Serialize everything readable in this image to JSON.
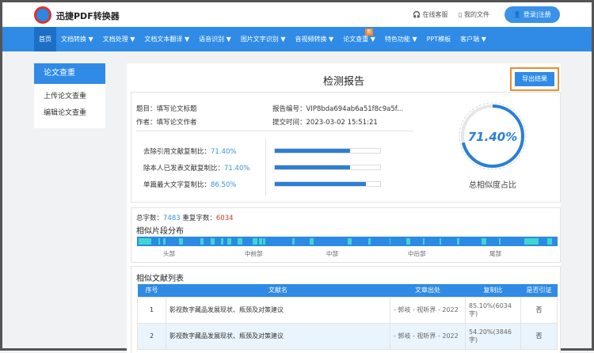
{
  "header": {
    "brand": "迅捷PDF转换器",
    "service": "在线客服",
    "files": "我的文件",
    "login": "登录|注册"
  },
  "nav": [
    {
      "label": "首页"
    },
    {
      "label": "文档转换 ▼"
    },
    {
      "label": "文档处理 ▼"
    },
    {
      "label": "文档文本翻译 ▼"
    },
    {
      "label": "语音识别 ▼"
    },
    {
      "label": "图片文字识别 ▼"
    },
    {
      "label": "音视频转换 ▼"
    },
    {
      "label": "论文查重 ▼",
      "badge": "新"
    },
    {
      "label": "特色功能 ▼"
    },
    {
      "label": "PPT模板"
    },
    {
      "label": "客户端 ▼"
    }
  ],
  "sidebar": {
    "title": "论文查重",
    "items": [
      "上传论文查重",
      "编辑论文查重"
    ]
  },
  "report": {
    "title": "检测报告",
    "export": "导出结果",
    "topic_label": "题目：",
    "topic": "填写论文标题",
    "author_label": "作者：",
    "author": "填写论文作者",
    "id_label": "报告编号：",
    "id": "VIP8bda694ab6a51f8c9a5f...",
    "time_label": "提交时间：",
    "time": "2023-03-02 15:51:21",
    "rates": [
      {
        "label": "去除引用文献复制比：",
        "value": "71.40%",
        "fraction": 0.714
      },
      {
        "label": "除本人已发表文献复制比：",
        "value": "71.40%",
        "fraction": 0.714
      },
      {
        "label": "单篇最大文字复制比：",
        "value": "86.50%",
        "fraction": 0.865
      }
    ],
    "total": {
      "value": "71.40%",
      "fraction": 0.714,
      "label": "总相似度占比"
    }
  },
  "stats": {
    "total_label": "总字数：",
    "total": "7483",
    "dup_label": "重复字数：",
    "dup": "6034"
  },
  "distribution": {
    "title": "相似片段分布",
    "labels": [
      "头部",
      "中前部",
      "中部",
      "中后部",
      "尾部"
    ],
    "segments": [
      [
        0.003,
        0.03
      ],
      [
        0.05,
        0.005
      ],
      [
        0.062,
        0.005
      ],
      [
        0.1,
        0.01
      ],
      [
        0.15,
        0.008
      ],
      [
        0.175,
        0.01
      ],
      [
        0.2,
        0.006
      ],
      [
        0.215,
        0.01
      ],
      [
        0.245,
        0.005
      ],
      [
        0.275,
        0.012
      ],
      [
        0.29,
        0.008
      ],
      [
        0.3,
        0.005
      ],
      [
        0.24,
        0.005
      ],
      [
        0.37,
        0.005
      ],
      [
        0.41,
        0.01
      ],
      [
        0.5,
        0.01
      ],
      [
        0.55,
        0.005
      ],
      [
        0.6,
        0.003
      ],
      [
        0.64,
        0.01
      ],
      [
        0.68,
        0.004
      ],
      [
        0.72,
        0.004
      ],
      [
        0.76,
        0.006
      ],
      [
        0.82,
        0.01
      ],
      [
        0.86,
        0.004
      ],
      [
        0.92,
        0.035
      ],
      [
        0.975,
        0.012
      ]
    ]
  },
  "table": {
    "title": "相似文献列表",
    "headers": [
      "序号",
      "文献名",
      "文章出处",
      "复制比",
      "是否引证"
    ],
    "rows": [
      [
        "1",
        "影视数字藏品发展现状、瓶颈及对策建议",
        "- 郭岐 - 视听界 - 2022",
        "85.10%(6034字)",
        "否"
      ],
      [
        "2",
        "影视数字藏品发展现状、瓶颈及对策建议",
        "- 郭岐 - 视听界 - 2022",
        "54.20%(3846字)",
        "否"
      ]
    ]
  }
}
